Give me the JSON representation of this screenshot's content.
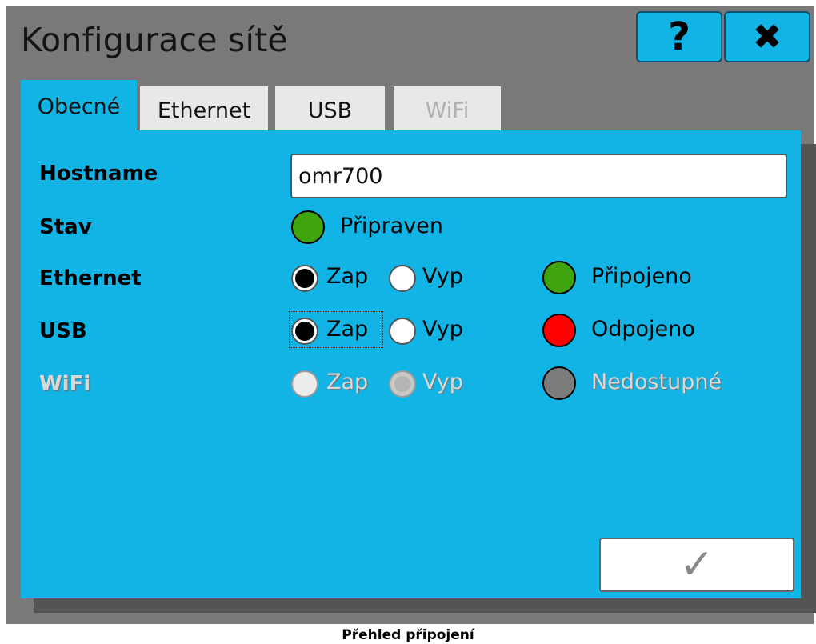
{
  "window": {
    "title": "Konfigurace sítě",
    "help_label": "?",
    "close_label": "✖"
  },
  "tabs": [
    {
      "label": "Obecné",
      "state": "active"
    },
    {
      "label": "Ethernet",
      "state": "normal"
    },
    {
      "label": "USB",
      "state": "normal"
    },
    {
      "label": "WiFi",
      "state": "disabled"
    }
  ],
  "form": {
    "hostname": {
      "label": "Hostname",
      "value": "omr700"
    },
    "status": {
      "label": "Stav",
      "text": "Připraven",
      "color": "#3fa40e"
    },
    "ethernet": {
      "label": "Ethernet",
      "on_label": "Zap",
      "off_label": "Vyp",
      "selected": "on",
      "status_text": "Připojeno",
      "status_color": "#3fa40e"
    },
    "usb": {
      "label": "USB",
      "on_label": "Zap",
      "off_label": "Vyp",
      "selected": "on",
      "status_text": "Odpojeno",
      "status_color": "#ff0000"
    },
    "wifi": {
      "label": "WiFi",
      "on_label": "Zap",
      "off_label": "Vyp",
      "selected": "off",
      "disabled": true,
      "status_text": "Nedostupné",
      "status_color": "#7c7c7c"
    }
  },
  "confirm_button": {
    "icon": "checkmark-icon",
    "label": "✓"
  },
  "caption": "Přehled připojení",
  "colors": {
    "accent": "#12b4e6",
    "window_bg": "#7b7879"
  }
}
